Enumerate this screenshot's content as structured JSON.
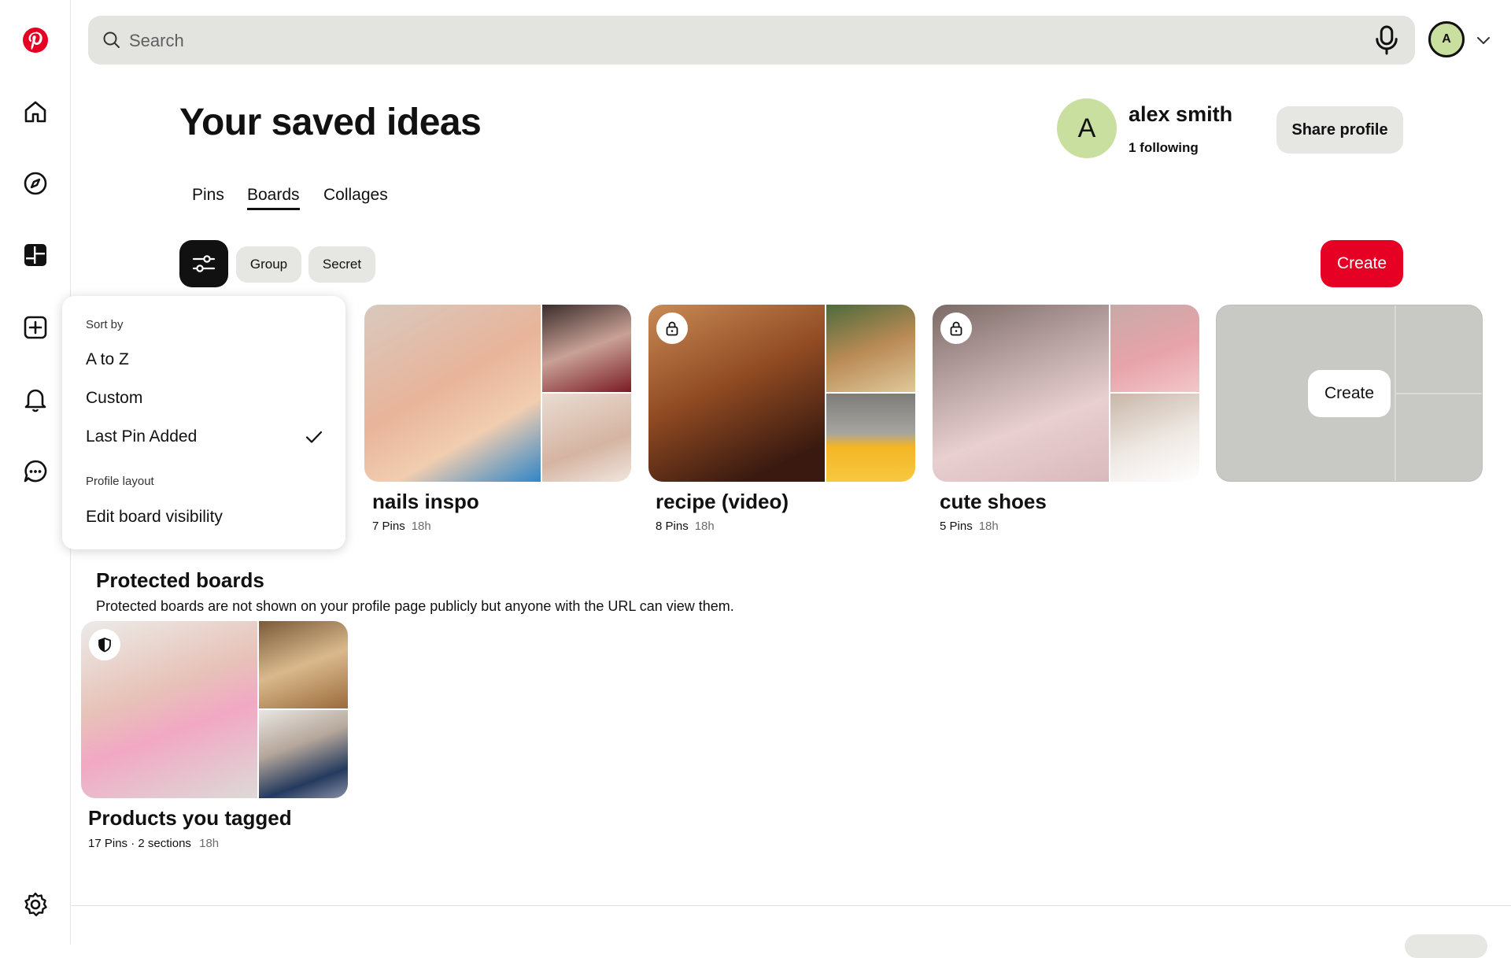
{
  "search": {
    "placeholder": "Search"
  },
  "user": {
    "avatar_initial": "A"
  },
  "header": {
    "title": "Your saved ideas",
    "profile_initial": "A",
    "profile_name": "alex smith",
    "following": "1 following",
    "share_label": "Share profile"
  },
  "tabs": [
    {
      "label": "Pins",
      "active": false
    },
    {
      "label": "Boards",
      "active": true
    },
    {
      "label": "Collages",
      "active": false
    }
  ],
  "toolbar": {
    "group_label": "Group",
    "secret_label": "Secret",
    "create_label": "Create"
  },
  "dropdown": {
    "sort_by_label": "Sort by",
    "options": [
      "A to Z",
      "Custom",
      "Last Pin Added"
    ],
    "selected": "Last Pin Added",
    "profile_layout_label": "Profile layout",
    "edit_visibility": "Edit board visibility"
  },
  "boards": [
    {
      "name": "nails inspo",
      "pins": "7 Pins",
      "age": "18h",
      "secret": false
    },
    {
      "name": "recipe (video)",
      "pins": "8 Pins",
      "age": "18h",
      "secret": true
    },
    {
      "name": "cute shoes",
      "pins": "5 Pins",
      "age": "18h",
      "secret": true
    }
  ],
  "empty_board": {
    "create_label": "Create"
  },
  "protected": {
    "title": "Protected boards",
    "description": "Protected boards are not shown on your profile page publicly but anyone with the URL can view them.",
    "board": {
      "name": "Products you tagged",
      "pins": "17 Pins",
      "sections": "2 sections",
      "age": "18h"
    }
  },
  "colors": {
    "brand_red": "#e60023",
    "avatar_green": "#c9dfa0",
    "chip_gray": "#e6e6e2"
  }
}
